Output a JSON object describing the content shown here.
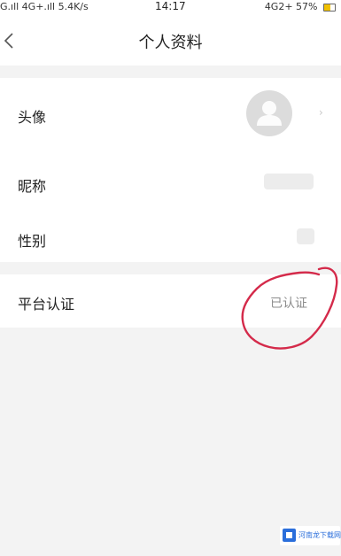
{
  "status_bar": {
    "left_text": "G.ıll 4G+.ıll 5.4K/s",
    "time": "14:17",
    "right_text": "4G2+ 57%",
    "battery_level": 0.57,
    "battery_color": "#f0c000"
  },
  "header": {
    "title": "个人资料",
    "back_icon": "chevron-left-icon"
  },
  "profile": {
    "avatar_label": "头像",
    "avatar_icon": "default-user-avatar-icon",
    "nickname_label": "昵称",
    "gender_label": "性别"
  },
  "certification": {
    "label": "平台认证",
    "value": "已认证"
  },
  "annotation": {
    "color": "#d42a4a"
  },
  "watermark": {
    "text": "河南龙下载网",
    "color": "#2a6edb"
  }
}
